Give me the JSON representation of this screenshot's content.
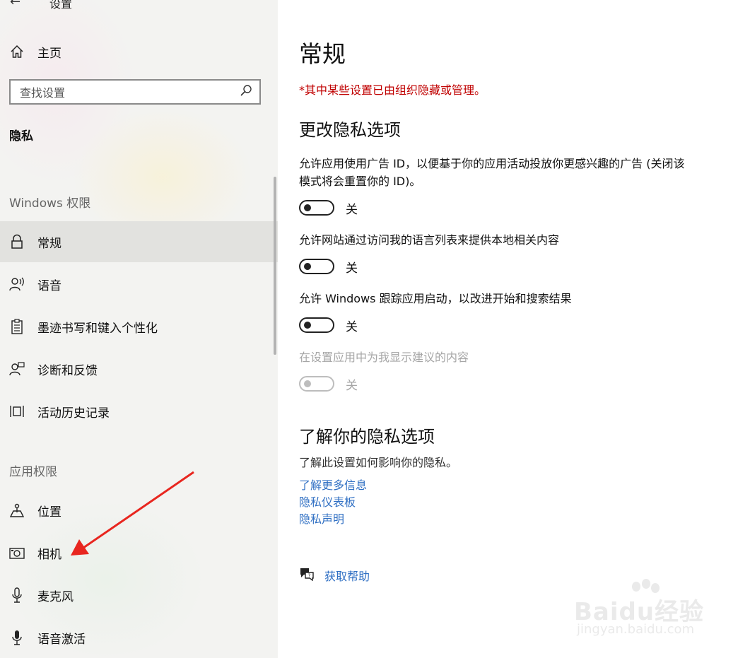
{
  "window": {
    "title": "设置"
  },
  "sidebar": {
    "home_label": "主页",
    "search_placeholder": "查找设置",
    "section_title": "隐私",
    "groups": {
      "windows_permissions": "Windows 权限",
      "app_permissions": "应用权限"
    },
    "items": [
      {
        "label": "常规",
        "icon": "lock-icon",
        "selected": true
      },
      {
        "label": "语音",
        "icon": "speech-icon"
      },
      {
        "label": "墨迹书写和键入个性化",
        "icon": "inking-icon"
      },
      {
        "label": "诊断和反馈",
        "icon": "feedback-icon"
      },
      {
        "label": "活动历史记录",
        "icon": "activity-history-icon"
      },
      {
        "label": "位置",
        "icon": "location-icon"
      },
      {
        "label": "相机",
        "icon": "camera-icon"
      },
      {
        "label": "麦克风",
        "icon": "microphone-icon"
      },
      {
        "label": "语音激活",
        "icon": "voice-activation-icon"
      }
    ]
  },
  "main": {
    "title": "常规",
    "notice": "*其中某些设置已由组织隐藏或管理。",
    "section_change": "更改隐私选项",
    "settings": [
      {
        "description": "允许应用使用广告 ID，以便基于你的应用活动投放你更感兴趣的广告 (关闭该模式将会重置你的 ID)。",
        "state": "关",
        "enabled": true
      },
      {
        "description": "允许网站通过访问我的语言列表来提供本地相关内容",
        "state": "关",
        "enabled": true
      },
      {
        "description": "允许 Windows 跟踪应用启动，以改进开始和搜索结果",
        "state": "关",
        "enabled": true
      },
      {
        "description": "在设置应用中为我显示建议的内容",
        "state": "关",
        "enabled": false
      }
    ],
    "section_learn": "了解你的隐私选项",
    "learn_text": "了解此设置如何影响你的隐私。",
    "links": [
      "了解更多信息",
      "隐私仪表板",
      "隐私声明"
    ],
    "help_label": "获取帮助"
  },
  "watermark": {
    "brand": "Baidu经验",
    "url": "jingyan.baidu.com"
  },
  "colors": {
    "notice": "#c00000",
    "link": "#2f6fc3",
    "annotation_arrow": "#e8261f",
    "selected_bg": "#e2e2df"
  }
}
